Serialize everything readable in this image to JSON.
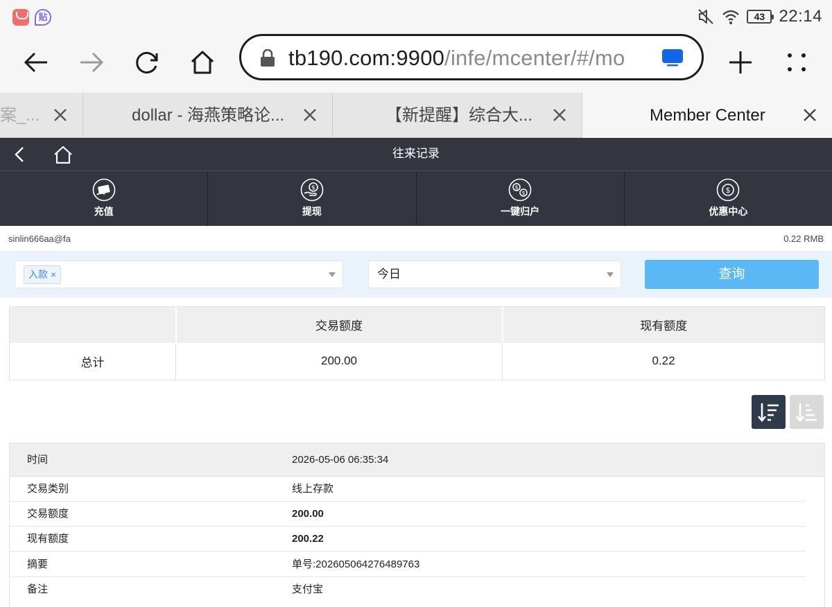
{
  "status_bar": {
    "time": "22:14",
    "battery": "43",
    "icons": [
      "mute-icon",
      "wifi-icon",
      "battery-icon"
    ]
  },
  "browser": {
    "url_host": "tb190.com:9900",
    "url_path": "/infe/mcenter/#/mo",
    "tabs": [
      {
        "title": "案_..."
      },
      {
        "title": "dollar - 海燕策略论..."
      },
      {
        "title": "【新提醒】综合大..."
      },
      {
        "title": "Member Center"
      }
    ]
  },
  "header": {
    "title": "往来记录"
  },
  "menu": [
    {
      "label": "充值",
      "icon": "deposit-card-icon"
    },
    {
      "label": "提现",
      "icon": "withdraw-coin-icon"
    },
    {
      "label": "一键归户",
      "icon": "transfer-coins-icon"
    },
    {
      "label": "优惠中心",
      "icon": "promo-coin-icon"
    }
  ],
  "account": {
    "username": "sinlin666aa@fa",
    "balance": "0.22 RMB"
  },
  "filter": {
    "type_tag": "入款",
    "date_value": "今日",
    "query_label": "查询"
  },
  "summary": {
    "headers": [
      "",
      "交易额度",
      "现有额度"
    ],
    "row": {
      "label": "总计",
      "amount": "200.00",
      "balance": "0.22"
    }
  },
  "record": {
    "time_label": "时间",
    "time_value": "2026-05-06 06:35:34",
    "rows": [
      {
        "key": "交易类别",
        "value": "线上存款"
      },
      {
        "key": "交易额度",
        "value": "200.00"
      },
      {
        "key": "现有额度",
        "value": "200.22"
      },
      {
        "key": "摘要",
        "value": "单号:202605064276489763"
      },
      {
        "key": "备注",
        "value": "支付宝"
      }
    ]
  },
  "colors": {
    "header_bg": "#33363f",
    "filter_bg": "#e8f3fc",
    "query_button": "#5ab8f5",
    "sort_active": "#2f3a4a"
  }
}
